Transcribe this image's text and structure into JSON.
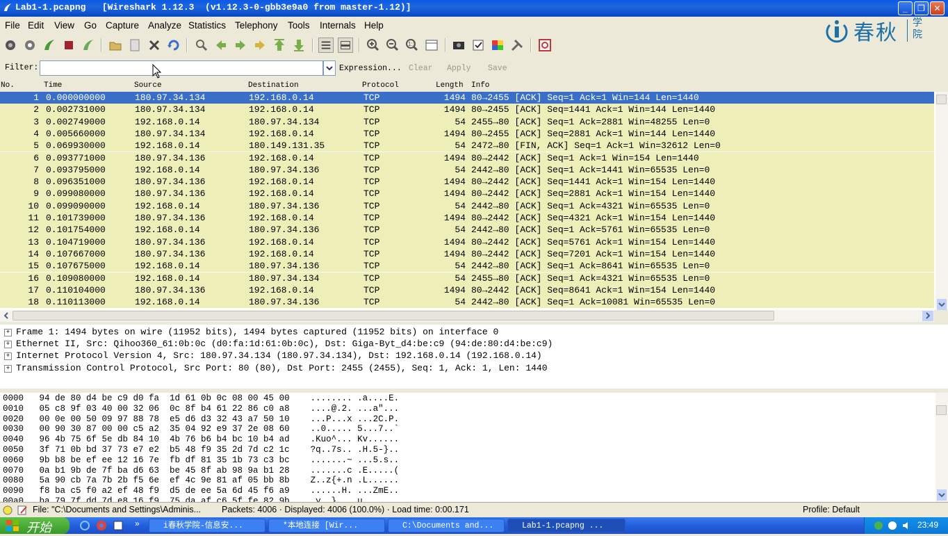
{
  "window": {
    "title": "Lab1-1.pcapng   [Wireshark 1.12.3  (v1.12.3-0-gbb3e9a0 from master-1.12)]"
  },
  "menu": [
    "File",
    "Edit",
    "View",
    "Go",
    "Capture",
    "Analyze",
    "Statistics",
    "Telephony",
    "Tools",
    "Internals",
    "Help"
  ],
  "logo": {
    "text": "春秋",
    "sub": "学院"
  },
  "filter": {
    "label": "Filter:",
    "value": "",
    "expression": "Expression...",
    "clear": "Clear",
    "apply": "Apply",
    "save": "Save"
  },
  "columns": {
    "no": "No.",
    "time": "Time",
    "source": "Source",
    "destination": "Destination",
    "protocol": "Protocol",
    "length": "Length",
    "info": "Info"
  },
  "packets": [
    {
      "no": "1",
      "time": "0.000000000",
      "src": "180.97.34.134",
      "dst": "192.168.0.14",
      "proto": "TCP",
      "len": "1494",
      "info": "80→2455 [ACK] Seq=1 Ack=1 Win=144 Len=1440"
    },
    {
      "no": "2",
      "time": "0.002731000",
      "src": "180.97.34.134",
      "dst": "192.168.0.14",
      "proto": "TCP",
      "len": "1494",
      "info": "80→2455 [ACK] Seq=1441 Ack=1 Win=144 Len=1440"
    },
    {
      "no": "3",
      "time": "0.002749000",
      "src": "192.168.0.14",
      "dst": "180.97.34.134",
      "proto": "TCP",
      "len": "54",
      "info": "2455→80 [ACK] Seq=1 Ack=2881 Win=48255 Len=0"
    },
    {
      "no": "4",
      "time": "0.005660000",
      "src": "180.97.34.134",
      "dst": "192.168.0.14",
      "proto": "TCP",
      "len": "1494",
      "info": "80→2455 [ACK] Seq=2881 Ack=1 Win=144 Len=1440"
    },
    {
      "no": "5",
      "time": "0.069930000",
      "src": "192.168.0.14",
      "dst": "180.149.131.35",
      "proto": "TCP",
      "len": "54",
      "info": "2472→80 [FIN, ACK] Seq=1 Ack=1 Win=32612 Len=0"
    },
    {
      "no": "6",
      "time": "0.093771000",
      "src": "180.97.34.136",
      "dst": "192.168.0.14",
      "proto": "TCP",
      "len": "1494",
      "info": "80→2442 [ACK] Seq=1 Ack=1 Win=154 Len=1440"
    },
    {
      "no": "7",
      "time": "0.093795000",
      "src": "192.168.0.14",
      "dst": "180.97.34.136",
      "proto": "TCP",
      "len": "54",
      "info": "2442→80 [ACK] Seq=1 Ack=1441 Win=65535 Len=0"
    },
    {
      "no": "8",
      "time": "0.096351000",
      "src": "180.97.34.136",
      "dst": "192.168.0.14",
      "proto": "TCP",
      "len": "1494",
      "info": "80→2442 [ACK] Seq=1441 Ack=1 Win=154 Len=1440"
    },
    {
      "no": "9",
      "time": "0.099080000",
      "src": "180.97.34.136",
      "dst": "192.168.0.14",
      "proto": "TCP",
      "len": "1494",
      "info": "80→2442 [ACK] Seq=2881 Ack=1 Win=154 Len=1440"
    },
    {
      "no": "10",
      "time": "0.099090000",
      "src": "192.168.0.14",
      "dst": "180.97.34.136",
      "proto": "TCP",
      "len": "54",
      "info": "2442→80 [ACK] Seq=1 Ack=4321 Win=65535 Len=0"
    },
    {
      "no": "11",
      "time": "0.101739000",
      "src": "180.97.34.136",
      "dst": "192.168.0.14",
      "proto": "TCP",
      "len": "1494",
      "info": "80→2442 [ACK] Seq=4321 Ack=1 Win=154 Len=1440"
    },
    {
      "no": "12",
      "time": "0.101754000",
      "src": "192.168.0.14",
      "dst": "180.97.34.136",
      "proto": "TCP",
      "len": "54",
      "info": "2442→80 [ACK] Seq=1 Ack=5761 Win=65535 Len=0"
    },
    {
      "no": "13",
      "time": "0.104719000",
      "src": "180.97.34.136",
      "dst": "192.168.0.14",
      "proto": "TCP",
      "len": "1494",
      "info": "80→2442 [ACK] Seq=5761 Ack=1 Win=154 Len=1440"
    },
    {
      "no": "14",
      "time": "0.107667000",
      "src": "180.97.34.136",
      "dst": "192.168.0.14",
      "proto": "TCP",
      "len": "1494",
      "info": "80→2442 [ACK] Seq=7201 Ack=1 Win=154 Len=1440"
    },
    {
      "no": "15",
      "time": "0.107675000",
      "src": "192.168.0.14",
      "dst": "180.97.34.136",
      "proto": "TCP",
      "len": "54",
      "info": "2442→80 [ACK] Seq=1 Ack=8641 Win=65535 Len=0"
    },
    {
      "no": "16",
      "time": "0.109080000",
      "src": "192.168.0.14",
      "dst": "180.97.34.134",
      "proto": "TCP",
      "len": "54",
      "info": "2455→80 [ACK] Seq=1 Ack=4321 Win=65535 Len=0"
    },
    {
      "no": "17",
      "time": "0.110104000",
      "src": "180.97.34.136",
      "dst": "192.168.0.14",
      "proto": "TCP",
      "len": "1494",
      "info": "80→2442 [ACK] Seq=8641 Ack=1 Win=154 Len=1440"
    },
    {
      "no": "18",
      "time": "0.110113000",
      "src": "192.168.0.14",
      "dst": "180.97.34.136",
      "proto": "TCP",
      "len": "54",
      "info": "2442→80 [ACK] Seq=1 Ack=10081 Win=65535 Len=0"
    }
  ],
  "details": [
    "Frame 1: 1494 bytes on wire (11952 bits), 1494 bytes captured (11952 bits) on interface 0",
    "Ethernet II, Src: Qihoo360_61:0b:0c (d0:fa:1d:61:0b:0c), Dst: Giga-Byt_d4:be:c9 (94:de:80:d4:be:c9)",
    "Internet Protocol Version 4, Src: 180.97.34.134 (180.97.34.134), Dst: 192.168.0.14 (192.168.0.14)",
    "Transmission Control Protocol, Src Port: 80 (80), Dst Port: 2455 (2455), Seq: 1, Ack: 1, Len: 1440"
  ],
  "hex": [
    "0000   94 de 80 d4 be c9 d0 fa  1d 61 0b 0c 08 00 45 00    ........ .a....E.",
    "0010   05 c8 9f 03 40 00 32 06  0c 8f b4 61 22 86 c0 a8    ....@.2. ...a\"...",
    "0020   00 0e 00 50 09 97 88 78  e5 d6 d3 32 43 a7 50 10    ...P...x ...2C.P.",
    "0030   00 90 30 87 00 00 c5 a2  35 04 92 e9 37 2e 08 60    ..0..... 5...7..`",
    "0040   96 4b 75 6f 5e db 84 10  4b 76 b6 b4 bc 10 b4 ad    .Kuo^... Kv......",
    "0050   3f 71 0b bd 37 73 e7 e2  b5 48 f9 35 2d 7d c2 1c    ?q..7s.. .H.5-}..",
    "0060   9b b8 be ef ee 12 16 7e  fb df 81 35 1b 73 c3 bc    .......~ ...5.s..",
    "0070   0a b1 9b de 7f ba d6 63  be 45 8f ab 98 9a b1 28    .......c .E.....(",
    "0080   5a 90 cb 7a 7b 2b f5 6e  ef 4c 9e 81 af 05 bb 8b    Z..z{+.n .L......",
    "0090   f8 ba c5 f0 a2 ef 48 f9  d5 de ee 5a 6d 45 f6 a9    ......H. ...ZmE..",
    "00a0   ba 79 7f dd 7d e8 16 f9  75 da af c6 5f fe 82 9b    .y..}... u..._..."
  ],
  "status": {
    "file": "File: \"C:\\Documents and Settings\\Adminis...",
    "packets": "Packets: 4006 · Displayed: 4006 (100.0%) · Load time: 0:00.171",
    "profile": "Profile: Default"
  },
  "taskbar": {
    "start": "开始",
    "tasks": [
      "i春秋学院-信息安...",
      "*本地连接  [Wir...",
      "C:\\Documents and...",
      "Lab1-1.pcapng  ..."
    ],
    "clock": "23:49"
  }
}
